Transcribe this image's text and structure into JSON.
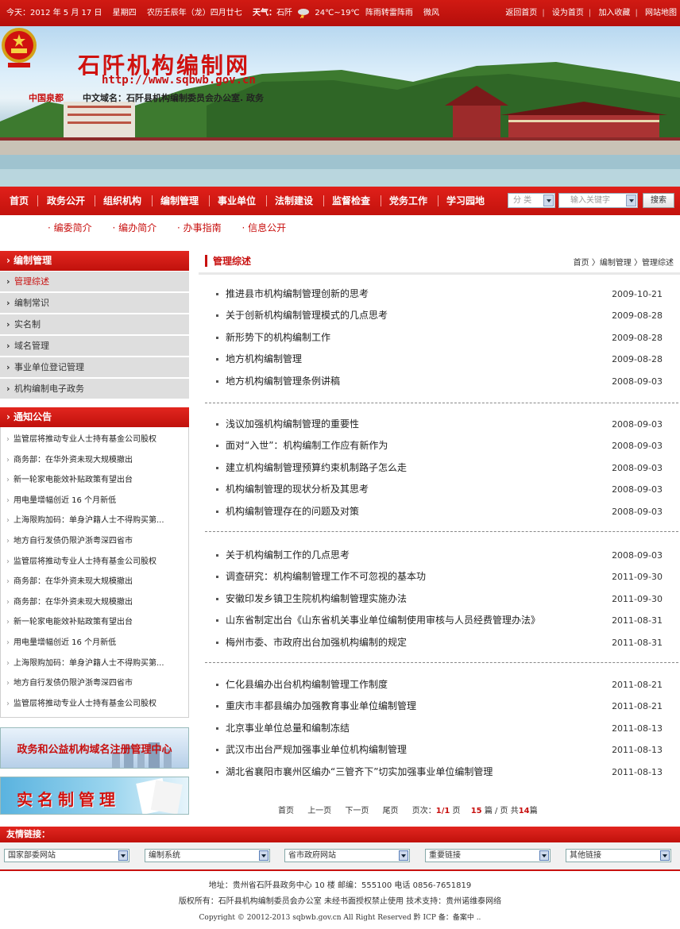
{
  "topbar": {
    "date": "今天：2012 年 5 月 17 日",
    "weekday": "星期四",
    "lunar": "农历壬辰年（龙）四月廿七",
    "weather_label": "天气：",
    "city": "石阡",
    "temperature": "24℃~19℃",
    "condition": "阵雨转雷阵雨",
    "wind": "微风",
    "links": [
      "返回首页",
      "设为首页",
      "加入收藏",
      "网站地图"
    ]
  },
  "banner": {
    "title": "石阡机构编制网",
    "url": "http://www.sqbwb.gov.cn",
    "city": "中国泉都",
    "domain": "中文域名：石阡县机构编制委员会办公室. 政务"
  },
  "nav": {
    "items": [
      "首页",
      "政务公开",
      "组织机构",
      "编制管理",
      "事业单位",
      "法制建设",
      "监督检查",
      "党务工作",
      "学习园地"
    ],
    "active_index": 1,
    "category_select": "分 类",
    "keyword_select": "输入关键字",
    "search_button": "搜索"
  },
  "subnav": [
    "编委简介",
    "编办简介",
    "办事指南",
    "信息公开"
  ],
  "side_menu": {
    "title": "编制管理",
    "items": [
      "管理综述",
      "编制常识",
      "实名制",
      "域名管理",
      "事业单位登记管理",
      "机构编制电子政务"
    ]
  },
  "notices": {
    "title": "通知公告",
    "items": [
      "监管层将推动专业人士持有基金公司股权",
      "商务部：在华外资未现大规模撤出",
      "新一轮家电能效补贴政策有望出台",
      "用电量增幅创近 16 个月新低",
      "上海限购加码：单身沪籍人士不得购买第...",
      "地方自行发债仍限沪浙粤深四省市",
      "监管层将推动专业人士持有基金公司股权",
      "商务部：在华外资未现大规模撤出",
      "商务部：在华外资未现大规模撤出",
      "新一轮家电能效补贴政策有望出台",
      "用电量增幅创近 16 个月新低",
      "上海限购加码：单身沪籍人士不得购买第...",
      "地方自行发债仍限沪浙粤深四省市",
      "监管层将推动专业人士持有基金公司股权"
    ]
  },
  "ads": {
    "ad1": "政务和公益机构域名注册管理中心",
    "ad2": "实名制管理"
  },
  "main": {
    "title": "管理综述",
    "breadcrumb": "首页 〉编制管理 〉管理综述",
    "groups": [
      [
        {
          "title": "推进县市机构编制管理创新的思考",
          "date": "2009-10-21"
        },
        {
          "title": "关于创新机构编制管理模式的几点思考",
          "date": "2009-08-28"
        },
        {
          "title": "新形势下的机构编制工作",
          "date": "2009-08-28"
        },
        {
          "title": "地方机构编制管理",
          "date": "2009-08-28"
        },
        {
          "title": "地方机构编制管理条例讲稿",
          "date": "2008-09-03"
        }
      ],
      [
        {
          "title": "浅议加强机构编制管理的重要性",
          "date": "2008-09-03"
        },
        {
          "title": "面对“入世”：机构编制工作应有新作为",
          "date": "2008-09-03"
        },
        {
          "title": "建立机构编制管理预算约束机制路子怎么走",
          "date": "2008-09-03"
        },
        {
          "title": "机构编制管理的现状分析及其思考",
          "date": "2008-09-03"
        },
        {
          "title": "机构编制管理存在的问题及对策",
          "date": "2008-09-03"
        }
      ],
      [
        {
          "title": "关于机构编制工作的几点思考",
          "date": "2008-09-03"
        },
        {
          "title": "调查研究：机构编制管理工作不可忽视的基本功",
          "date": "2011-09-30"
        },
        {
          "title": "安徽印发乡镇卫生院机构编制管理实施办法",
          "date": "2011-09-30"
        },
        {
          "title": "山东省制定出台《山东省机关事业单位编制使用审核与人员经费管理办法》",
          "date": "2011-08-31"
        },
        {
          "title": "梅州市委、市政府出台加强机构编制的规定",
          "date": "2011-08-31"
        }
      ],
      [
        {
          "title": "仁化县编办出台机构编制管理工作制度",
          "date": "2011-08-21"
        },
        {
          "title": "重庆市丰都县编办加强教育事业单位编制管理",
          "date": "2011-08-21"
        },
        {
          "title": "北京事业单位总量和编制冻结",
          "date": "2011-08-13"
        },
        {
          "title": "武汉市出台严规加强事业单位机构编制管理",
          "date": "2011-08-13"
        },
        {
          "title": "湖北省襄阳市襄州区编办“三管齐下”切实加强事业单位编制管理",
          "date": "2011-08-13"
        }
      ]
    ]
  },
  "pager": {
    "first": "首页",
    "prev": "上一页",
    "next": "下一页",
    "last": "尾页",
    "page_label": "页次：",
    "page_value": "1/1",
    "page_suffix": "页",
    "per_page": "15",
    "per_page_suffix": "篇 / 页 共",
    "total": "14",
    "total_suffix": "篇"
  },
  "friend_links": {
    "title": "友情链接：",
    "selects": [
      "国家部委网站",
      "编制系统",
      "省市政府网站",
      "重要链接",
      "其他链接"
    ]
  },
  "footer": {
    "address": "地址：贵州省石阡县政务中心 10 楼    邮编：555100  电话 0856-7651819",
    "copyright": "版权所有：石阡县机构编制委员会办公室  未经书面授权禁止使用  技术支持：贵州诺维泰网络",
    "copyright_en": "Copyright © 20012-2013 sqbwb.gov.cn All Right Reserved 黔 ICP 备：备案中 .."
  },
  "colors": {
    "brand_red": "#c8100f",
    "nav_red": "#d8180f"
  }
}
